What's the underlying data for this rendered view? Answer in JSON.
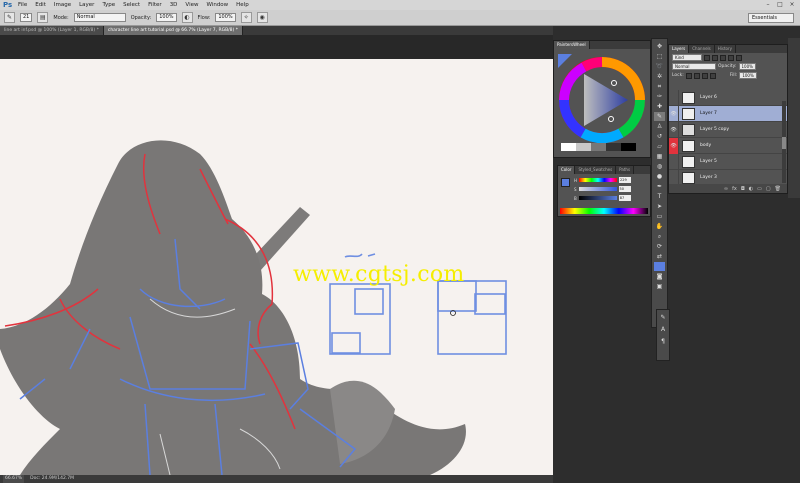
{
  "app": {
    "logo": "Ps"
  },
  "menu": [
    "File",
    "Edit",
    "Image",
    "Layer",
    "Type",
    "Select",
    "Filter",
    "3D",
    "View",
    "Window",
    "Help"
  ],
  "window_controls": [
    "–",
    "□",
    "×"
  ],
  "options_bar": {
    "brush_size": "21",
    "mode_label": "Mode:",
    "mode_value": "Normal",
    "opacity_label": "Opacity:",
    "opacity_value": "100%",
    "flow_label": "Flow:",
    "flow_value": "100%",
    "workspace": "Essentials"
  },
  "doc_tabs": [
    {
      "label": "line art inf.psd @ 100% (Layer 1, RGB/8) *",
      "active": false
    },
    {
      "label": "character line art tutorial.psd @ 66.7% (Layer 7, RGB/8) *",
      "active": true
    }
  ],
  "status": {
    "zoom": "66.67%",
    "doc": "Doc: 24.9M/142.7M"
  },
  "watermark": "www.cgtsj.com",
  "wheel_panel": {
    "title": "PaintersWheel"
  },
  "color_panel": {
    "tabs": [
      "Color",
      "Styled_Swatches",
      "Paths"
    ],
    "sliders": [
      {
        "label": "H",
        "value": "229"
      },
      {
        "label": "S",
        "value": "50"
      },
      {
        "label": "B",
        "value": "87"
      }
    ]
  },
  "layers_panel": {
    "tabs": [
      "Layers",
      "Channels",
      "History"
    ],
    "kind_label": "Kind",
    "blend_mode": "Normal",
    "opacity_label": "Opacity:",
    "opacity_value": "100%",
    "lock_label": "Lock:",
    "fill_label": "Fill:",
    "fill_value": "100%",
    "layers": [
      {
        "name": "Layer 6",
        "visible": false,
        "selected": false
      },
      {
        "name": "Layer 7",
        "visible": true,
        "selected": true
      },
      {
        "name": "Layer 5 copy",
        "visible": true,
        "selected": false
      },
      {
        "name": "body",
        "visible": true,
        "selected": false
      },
      {
        "name": "Layer 5",
        "visible": false,
        "selected": false
      },
      {
        "name": "Layer 3",
        "visible": false,
        "selected": false
      }
    ]
  },
  "colors": {
    "canvas": "#f6f2ef",
    "accent_blue": "#5b7fe0",
    "accent_red": "#e2333d",
    "layer_selected": "#a0aed4",
    "watermark": "#f5ee00"
  },
  "icons": {
    "brush": "brush-icon",
    "move": "move-tool-icon",
    "eye": "eye-icon"
  }
}
